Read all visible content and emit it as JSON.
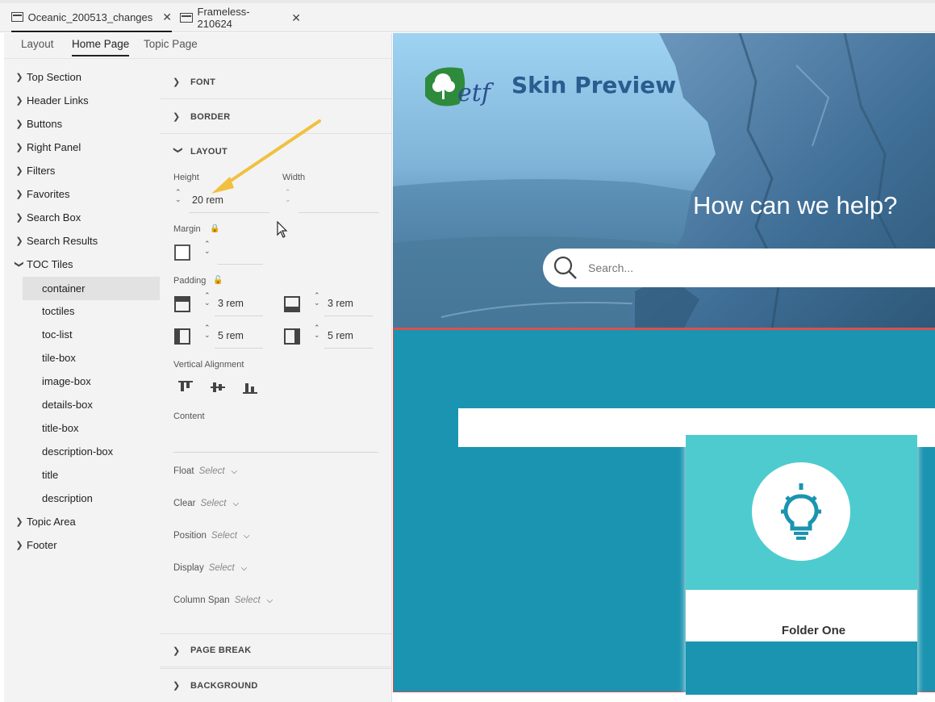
{
  "document_tabs": [
    {
      "label": "Oceanic_200513_changes",
      "active": true
    },
    {
      "label": "Frameless-210624",
      "active": false
    }
  ],
  "sub_tabs": [
    {
      "label": "Layout",
      "active": false
    },
    {
      "label": "Home Page",
      "active": true
    },
    {
      "label": "Topic Page",
      "active": false
    }
  ],
  "tree": {
    "items": [
      {
        "label": "Top Section",
        "expanded": false
      },
      {
        "label": "Header Links",
        "expanded": false
      },
      {
        "label": "Buttons",
        "expanded": false
      },
      {
        "label": "Right Panel",
        "expanded": false
      },
      {
        "label": "Filters",
        "expanded": false
      },
      {
        "label": "Favorites",
        "expanded": false
      },
      {
        "label": "Search Box",
        "expanded": false
      },
      {
        "label": "Search Results",
        "expanded": false
      },
      {
        "label": "TOC Tiles",
        "expanded": true
      },
      {
        "label": "Topic Area",
        "expanded": false
      },
      {
        "label": "Footer",
        "expanded": false
      }
    ],
    "toc_children": [
      "container",
      "toctiles",
      "toc-list",
      "tile-box",
      "image-box",
      "details-box",
      "title-box",
      "description-box",
      "title",
      "description"
    ],
    "selected": "container"
  },
  "properties": {
    "sections": {
      "font": "FONT",
      "border": "BORDER",
      "layout": "LAYOUT",
      "page_break": "PAGE BREAK",
      "background": "BACKGROUND"
    },
    "height_label": "Height",
    "height_value": "20 rem",
    "width_label": "Width",
    "width_value": "",
    "margin_label": "Margin",
    "padding_label": "Padding",
    "padding_top": "3 rem",
    "padding_bottom": "3 rem",
    "padding_left": "5 rem",
    "padding_right": "5 rem",
    "vertical_alignment_label": "Vertical Alignment",
    "content_label": "Content",
    "selects": [
      {
        "label": "Float",
        "value": "Select"
      },
      {
        "label": "Clear",
        "value": "Select"
      },
      {
        "label": "Position",
        "value": "Select"
      },
      {
        "label": "Display",
        "value": "Select"
      },
      {
        "label": "Column Span",
        "value": "Select"
      }
    ]
  },
  "preview": {
    "logo_text": "etf",
    "title": "Skin Preview",
    "help_text": "How can we help?",
    "search_placeholder": "Search...",
    "tile_title": "Folder One"
  },
  "colors": {
    "accent_teal": "#1a94b0",
    "tile_top": "#4ecbcf",
    "title_blue": "#2b5c8f",
    "annotation_arrow": "#f0c040",
    "tile_icon": "#1a94b0"
  }
}
